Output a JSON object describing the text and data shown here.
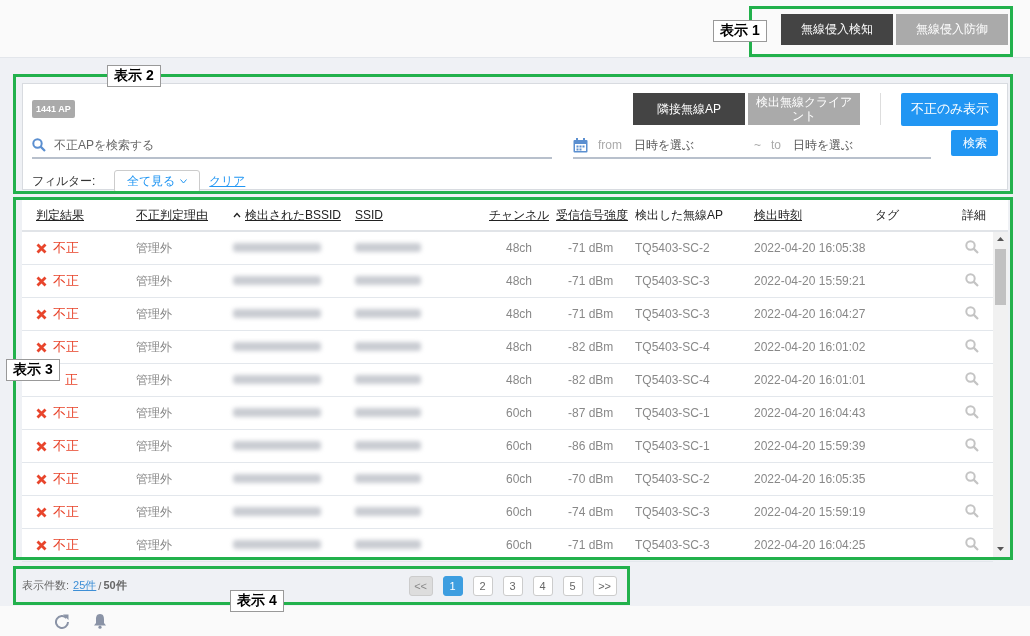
{
  "mode_buttons": [
    {
      "label": "無線侵入検知",
      "selected": true
    },
    {
      "label": "無線侵入防御",
      "selected": false
    }
  ],
  "filter_panel": {
    "count_badge": "1441 AP",
    "tabs": [
      {
        "label": "隣接無線AP",
        "selected": true
      },
      {
        "label": "検出無線クライアント",
        "selected": false
      }
    ],
    "rogue_only_button": "不正のみ表示",
    "search": {
      "placeholder": "不正APを検索する"
    },
    "date_range": {
      "from_label": "from",
      "from_placeholder": "日時を選ぶ",
      "separator": "~",
      "to_label": "to",
      "to_placeholder": "日時を選ぶ"
    },
    "search_button": "検索",
    "filter_label": "フィルター:",
    "filter_dropdown": "全て見る",
    "clear_link": "クリア"
  },
  "table": {
    "columns": [
      {
        "label": "判定結果",
        "sortable": true
      },
      {
        "label": "不正判定理由",
        "sortable": true
      },
      {
        "label": "検出されたBSSID",
        "sortable": true,
        "sorted": true
      },
      {
        "label": "SSID",
        "sortable": true
      },
      {
        "label": "チャンネル",
        "sortable": true
      },
      {
        "label": "受信信号強度",
        "sortable": true
      },
      {
        "label": "検出した無線AP",
        "sortable": false
      },
      {
        "label": "検出時刻",
        "sortable": true
      },
      {
        "label": "タグ",
        "sortable": false
      },
      {
        "label": "詳細",
        "sortable": false
      }
    ],
    "rows": [
      {
        "verdict": "不正",
        "reason": "管理外",
        "bssid_redacted": true,
        "ssid_redacted": true,
        "channel": "48ch",
        "rssi": "-71 dBm",
        "ap": "TQ5403-SC-2",
        "time": "2022-04-20 16:05:38"
      },
      {
        "verdict": "不正",
        "reason": "管理外",
        "bssid_redacted": true,
        "ssid_redacted": true,
        "channel": "48ch",
        "rssi": "-71 dBm",
        "ap": "TQ5403-SC-3",
        "time": "2022-04-20 15:59:21"
      },
      {
        "verdict": "不正",
        "reason": "管理外",
        "bssid_redacted": true,
        "ssid_redacted": true,
        "channel": "48ch",
        "rssi": "-71 dBm",
        "ap": "TQ5403-SC-3",
        "time": "2022-04-20 16:04:27"
      },
      {
        "verdict": "不正",
        "reason": "管理外",
        "bssid_redacted": true,
        "ssid_redacted": true,
        "channel": "48ch",
        "rssi": "-82 dBm",
        "ap": "TQ5403-SC-4",
        "time": "2022-04-20 16:01:02"
      },
      {
        "verdict": "正",
        "cross_icon": false,
        "reason": "管理外",
        "bssid_redacted": true,
        "ssid_redacted": true,
        "channel": "48ch",
        "rssi": "-82 dBm",
        "ap": "TQ5403-SC-4",
        "time": "2022-04-20 16:01:01"
      },
      {
        "verdict": "不正",
        "reason": "管理外",
        "bssid_redacted": true,
        "ssid_redacted": true,
        "channel": "60ch",
        "rssi": "-87 dBm",
        "ap": "TQ5403-SC-1",
        "time": "2022-04-20 16:04:43"
      },
      {
        "verdict": "不正",
        "reason": "管理外",
        "bssid_redacted": true,
        "ssid_redacted": true,
        "channel": "60ch",
        "rssi": "-86 dBm",
        "ap": "TQ5403-SC-1",
        "time": "2022-04-20 15:59:39"
      },
      {
        "verdict": "不正",
        "reason": "管理外",
        "bssid_redacted": true,
        "ssid_redacted": true,
        "channel": "60ch",
        "rssi": "-70 dBm",
        "ap": "TQ5403-SC-2",
        "time": "2022-04-20 16:05:35"
      },
      {
        "verdict": "不正",
        "reason": "管理外",
        "bssid_redacted": true,
        "ssid_redacted": true,
        "channel": "60ch",
        "rssi": "-74 dBm",
        "ap": "TQ5403-SC-3",
        "time": "2022-04-20 15:59:19"
      },
      {
        "verdict": "不正",
        "reason": "管理外",
        "bssid_redacted": true,
        "ssid_redacted": true,
        "channel": "60ch",
        "rssi": "-71 dBm",
        "ap": "TQ5403-SC-3",
        "time": "2022-04-20 16:04:25"
      }
    ]
  },
  "pagination": {
    "count_label": "表示件数:",
    "page_size_link": "25件",
    "separator": "/",
    "total": "50件",
    "first": {
      "label": "<<",
      "disabled": true
    },
    "pages": [
      {
        "label": "1",
        "selected": true
      },
      {
        "label": "2",
        "selected": false
      },
      {
        "label": "3",
        "selected": false
      },
      {
        "label": "4",
        "selected": false
      },
      {
        "label": "5",
        "selected": false
      }
    ],
    "last": {
      "label": ">>",
      "disabled": false
    }
  },
  "annotations": [
    {
      "label": "表示 1"
    },
    {
      "label": "表示 2"
    },
    {
      "label": "表示 3"
    },
    {
      "label": "表示 4"
    }
  ]
}
